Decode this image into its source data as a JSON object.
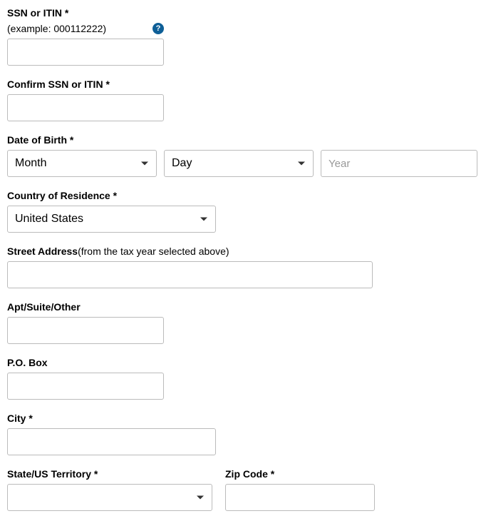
{
  "ssn": {
    "label": "SSN or ITIN *",
    "example": "(example: 000112222)",
    "value": ""
  },
  "confirmSsn": {
    "label": "Confirm SSN or ITIN *",
    "value": ""
  },
  "dob": {
    "label": "Date of Birth *",
    "month_placeholder": "Month",
    "day_placeholder": "Day",
    "year_placeholder": "Year"
  },
  "country": {
    "label": "Country of Residence *",
    "value": "United States"
  },
  "street": {
    "label": "Street Address ",
    "note": "(from the tax year selected above)",
    "value": ""
  },
  "apt": {
    "label": "Apt/Suite/Other",
    "value": ""
  },
  "pobox": {
    "label": "P.O. Box",
    "value": ""
  },
  "city": {
    "label": "City *",
    "value": ""
  },
  "state": {
    "label": "State/US Territory *",
    "value": ""
  },
  "zip": {
    "label": "Zip Code *",
    "value": ""
  }
}
